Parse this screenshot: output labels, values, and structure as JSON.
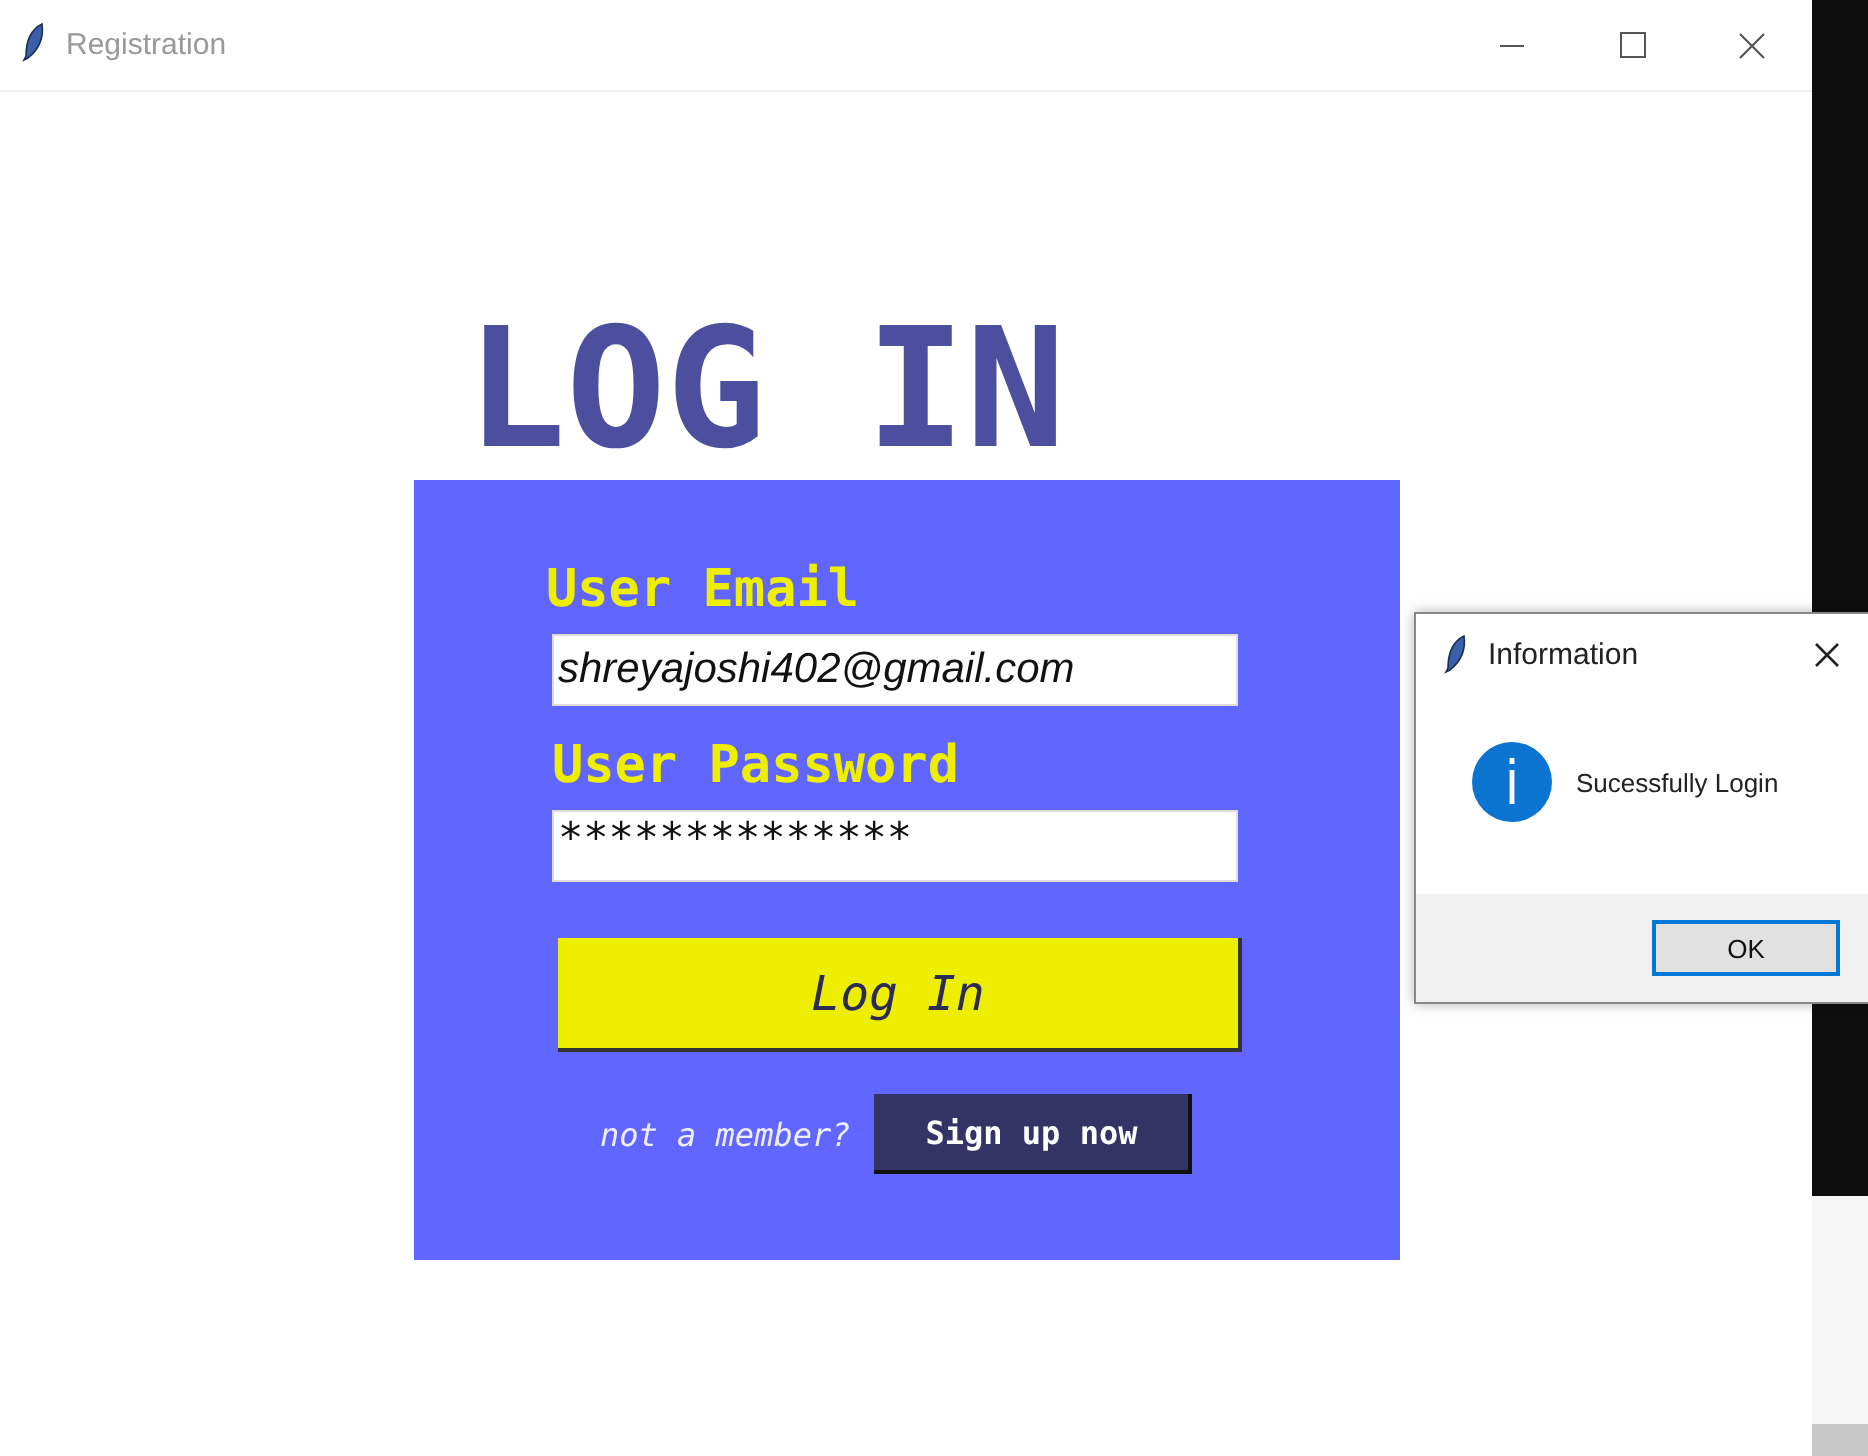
{
  "window": {
    "title": "Registration"
  },
  "heading": "LOG IN",
  "form": {
    "email_label": "User Email",
    "email_value": "shreyajoshi402@gmail.com",
    "password_label": "User Password",
    "password_value": "**************",
    "login_button": "Log In",
    "signup_prompt": "not a member?",
    "signup_button": "Sign up now"
  },
  "dialog": {
    "title": "Information",
    "message": "Sucessfully Login",
    "ok_button": "OK"
  }
}
